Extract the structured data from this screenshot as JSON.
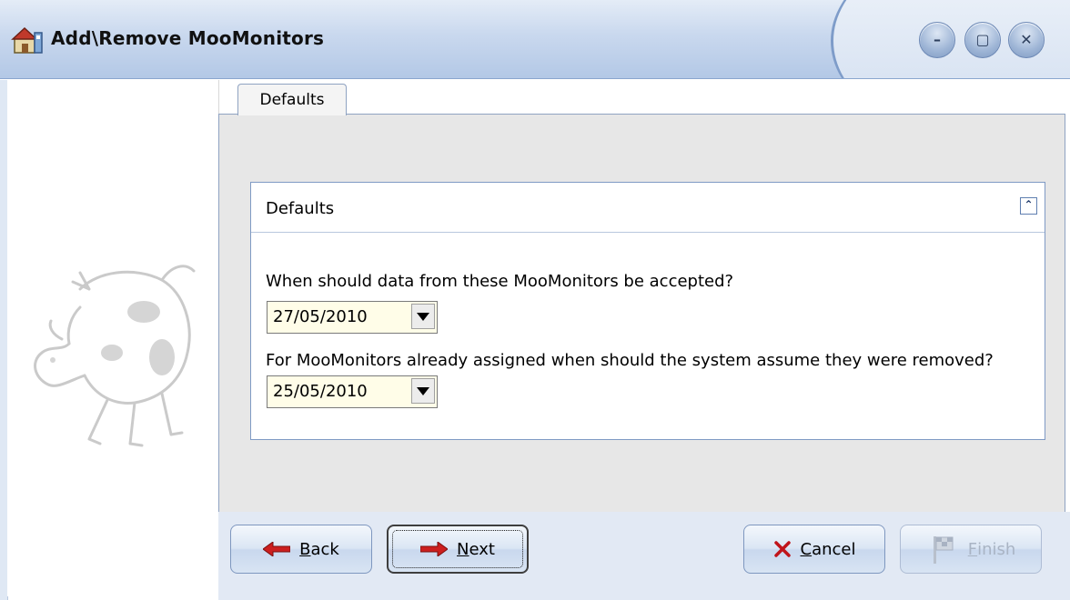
{
  "window": {
    "title": "Add\\Remove MooMonitors",
    "controls": {
      "minimize": "–",
      "maximize": "▢",
      "close": "✕"
    }
  },
  "tabs": [
    {
      "label": "Defaults",
      "active": true
    }
  ],
  "group": {
    "title": "Defaults",
    "collapse_glyph": "⌃",
    "question_accept": "When should data from these MooMonitors be accepted?",
    "accept_date": "27/05/2010",
    "question_removed": "For MooMonitors already assigned when should the system assume they were removed?",
    "removed_date": "25/05/2010"
  },
  "buttons": {
    "back": {
      "label_underline": "B",
      "label_rest": "ack"
    },
    "next": {
      "label_underline": "N",
      "label_rest": "ext"
    },
    "cancel": {
      "label_underline": "C",
      "label_rest": "ancel"
    },
    "finish": {
      "label_underline": "F",
      "label_rest": "inish",
      "enabled": false
    }
  },
  "colors": {
    "title_bar": "#c9d8ee",
    "arrow_red": "#cc1f1f",
    "field_bg": "#fffde8"
  }
}
